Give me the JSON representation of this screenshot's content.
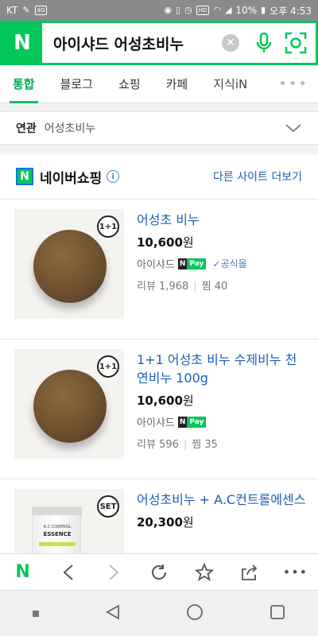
{
  "status_bar": {
    "carrier": "KT",
    "lte": "4G",
    "hd": "HD",
    "battery": "10%",
    "time": "오후 4:53"
  },
  "search": {
    "query": "아이샤드 어성초비누",
    "logo": "N"
  },
  "tabs": [
    {
      "label": "통합"
    },
    {
      "label": "블로그"
    },
    {
      "label": "쇼핑"
    },
    {
      "label": "카페"
    },
    {
      "label": "지식iN"
    }
  ],
  "related": {
    "label": "연관",
    "keyword": "어성초비누"
  },
  "shopping": {
    "logo": "N",
    "title": "네이버쇼핑",
    "more_link": "다른 사이트 더보기",
    "products": [
      {
        "badge": "1+1",
        "title": "어성초 비누",
        "price_num": "10,600",
        "price_unit": "원",
        "seller": "아이샤드",
        "official": "공식몰",
        "reviews": "리뷰 1,968",
        "likes": "찜 40"
      },
      {
        "badge": "1+1",
        "title": "1+1 어성초 비누 수제비누 천연비누 100g",
        "price_num": "10,600",
        "price_unit": "원",
        "seller": "아이샤드",
        "reviews": "리뷰 596",
        "likes": "찜 35"
      },
      {
        "badge": "SET",
        "title": "어성초비누 + A.C컨트롤에센스",
        "price_num": "20,300",
        "price_unit": "원",
        "tube_line1": "A.C CONTROL",
        "tube_line2": "ESSENCE"
      }
    ]
  },
  "npay": {
    "n": "N",
    "pay": "Pay"
  },
  "colors": {
    "naver_green": "#03c75a",
    "link_blue": "#1e5db7"
  }
}
